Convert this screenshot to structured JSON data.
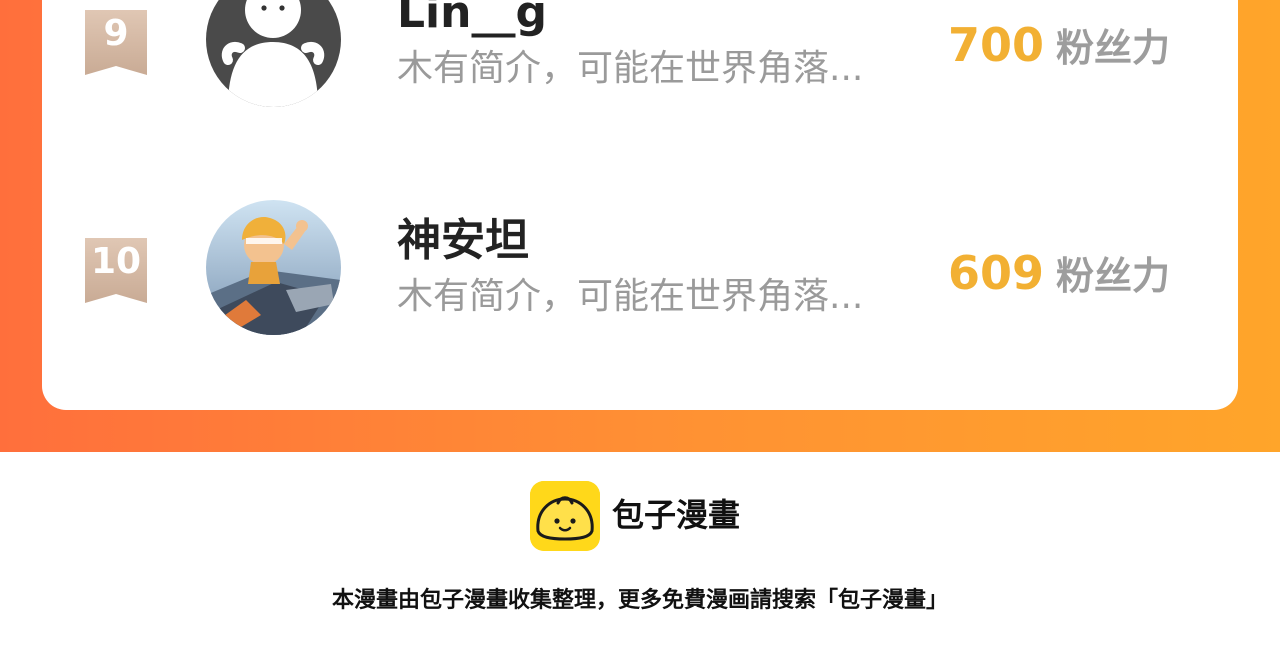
{
  "theme": {
    "accent_orange": "#ff7a35",
    "fans_number_color": "#f2b033",
    "badge_color": "#d7bfae",
    "logo_yellow": "#ffd81a"
  },
  "ranking": {
    "entries": [
      {
        "rank": "9",
        "name": "Lin__g",
        "bio": "木有简介，可能在世界角落...",
        "fans_count": "700",
        "fans_label": "粉丝力",
        "avatar_icon": "default-user-avatar-icon"
      },
      {
        "rank": "10",
        "name": "神安坦",
        "bio": "木有简介，可能在世界角落...",
        "fans_count": "609",
        "fans_label": "粉丝力",
        "avatar_icon": "game-character-avatar-icon"
      }
    ]
  },
  "footer": {
    "brand": "包子漫畫",
    "logo_icon": "bun-mascot-icon",
    "note": "本漫畫由包子漫畫收集整理，更多免費漫画請搜索「包子漫畫」"
  }
}
